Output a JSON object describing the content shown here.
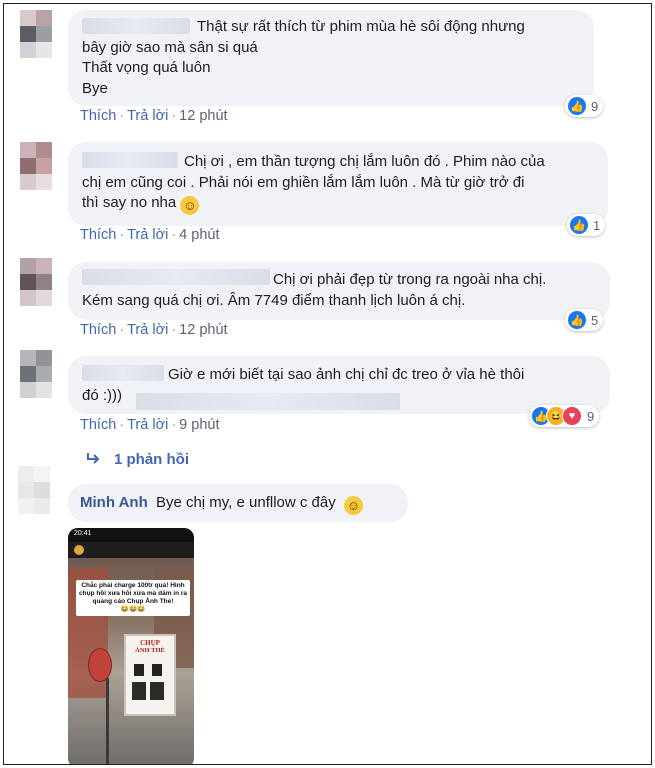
{
  "comments": [
    {
      "lines": [
        "Thật sự rất thích từ phim mùa hè sôi động nhưng",
        "bây giờ sao mà sân si quá",
        "Thất vọng quá luôn",
        "Bye"
      ],
      "like_label": "Thích",
      "reply_label": "Trả lời",
      "time": "12 phút",
      "reaction_count": "9"
    },
    {
      "lines": [
        "Chị ơi , em thần tượng chị lắm luôn đó . Phim nào của",
        "chị em cũng coi . Phải nói em ghiền lắm lắm luôn . Mà từ giờ trở đi",
        "thì say no nha"
      ],
      "like_label": "Thích",
      "reply_label": "Trả lời",
      "time": "4 phút",
      "reaction_count": "1"
    },
    {
      "lines": [
        "Chị ơi phải đẹp từ trong ra ngoài nha chị.",
        "Kém sang quá chị ơi. Âm 7749 điểm thanh lịch luôn á chị."
      ],
      "like_label": "Thích",
      "reply_label": "Trả lời",
      "time": "12 phút",
      "reaction_count": "5"
    },
    {
      "lines": [
        "Giờ e mới biết tại sao ảnh chị chỉ đc treo ở vỉa hè thôi",
        "đó :)))"
      ],
      "like_label": "Thích",
      "reply_label": "Trả lời",
      "time": "9 phút",
      "reaction_count": "9"
    }
  ],
  "replies_link": {
    "icon": "reply-arrow-icon",
    "label": "1 phản hồi"
  },
  "reply": {
    "name": "Minh Anh",
    "text": "Bye chị my, e unfllow c đây"
  },
  "photo": {
    "status_time": "20:41",
    "caption": "Chắc phải charge 100tr quá! Hình chụp hồi xưa hồi xưa mà dám in ra quảng cáo Chụp Ảnh Thẻ!",
    "emoji": "😂😂😂",
    "sign_title_1": "CHỤP",
    "sign_title_2": "ẢNH THẺ"
  },
  "colors": {
    "link": "#4267b2",
    "name": "#385898",
    "like": "#1877f2",
    "bubble": "#f0f2f5"
  }
}
